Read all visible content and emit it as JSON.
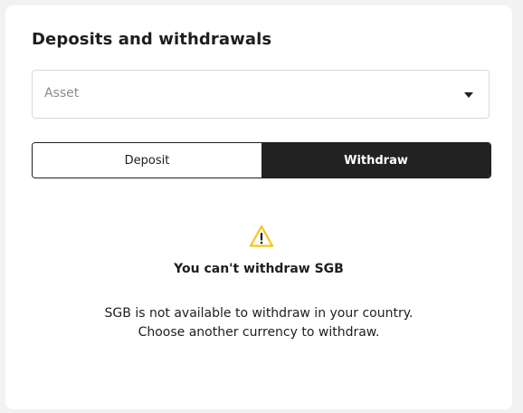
{
  "card": {
    "title": "Deposits and withdrawals"
  },
  "asset_select": {
    "placeholder": "Asset",
    "icon": "caret-down-icon"
  },
  "mode_toggle": {
    "deposit_label": "Deposit",
    "withdraw_label": "Withdraw",
    "selected": "Withdraw"
  },
  "notice": {
    "icon": "warning-icon",
    "icon_color": "#f5c518",
    "title": "You can't withdraw SGB",
    "line1": "SGB is not available to withdraw in your country.",
    "line2": "Choose another currency to withdraw."
  },
  "colors": {
    "active_toggle_bg": "#222222",
    "page_bg": "#f2f2f2",
    "card_bg": "#ffffff"
  }
}
